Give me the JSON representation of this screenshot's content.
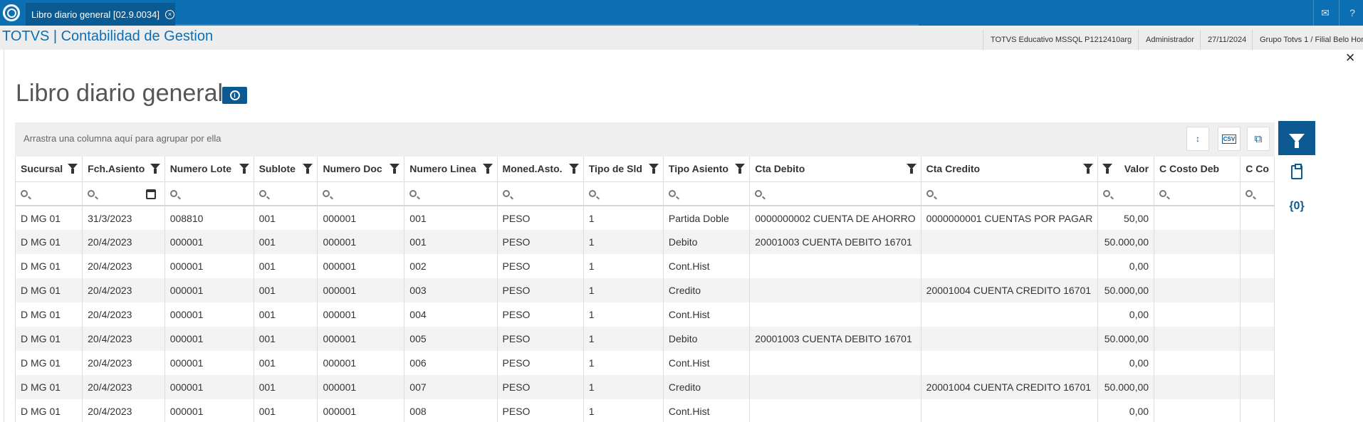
{
  "topbar": {
    "tab_label": "Libro diario general [02.9.0034]",
    "tab_close": "×",
    "mail_icon": "envelope-icon",
    "help_icon": "question-icon"
  },
  "appbar": {
    "title": "TOTVS | Contabilidad de Gestion",
    "environment": "TOTVS Educativo MSSQL P1212410arg",
    "user": "Administrador",
    "date": "27/11/2024",
    "company": "Grupo Totvs 1 / Filial Belo Hor"
  },
  "page": {
    "close": "×",
    "title": "Libro diario general",
    "info_icon": "i"
  },
  "grid": {
    "group_hint": "Arrastra una columna aquí para agrupar por ella",
    "columns": [
      "Sucursal",
      "Fch.Asiento",
      "Numero Lote",
      "Sublote",
      "Numero Doc",
      "Numero Linea",
      "Moned.Asto.",
      "Tipo de Sld",
      "Tipo Asiento",
      "Cta Debito",
      "Cta Credito",
      "Valor",
      "C Costo Deb",
      "C Co"
    ],
    "rows": [
      [
        "D MG 01",
        "31/3/2023",
        "008810",
        "001",
        "000001",
        "001",
        "PESO",
        "1",
        "Partida Doble",
        "0000000002 CUENTA DE AHORRO",
        "0000000001 CUENTAS POR PAGAR",
        "50,00",
        "",
        ""
      ],
      [
        "D MG 01",
        "20/4/2023",
        "000001",
        "001",
        "000001",
        "001",
        "PESO",
        "1",
        "Debito",
        "20001003 CUENTA DEBITO 16701",
        "",
        "50.000,00",
        "",
        ""
      ],
      [
        "D MG 01",
        "20/4/2023",
        "000001",
        "001",
        "000001",
        "002",
        "PESO",
        "1",
        "Cont.Hist",
        "",
        "",
        "0,00",
        "",
        ""
      ],
      [
        "D MG 01",
        "20/4/2023",
        "000001",
        "001",
        "000001",
        "003",
        "PESO",
        "1",
        "Credito",
        "",
        "20001004 CUENTA CREDITO 16701",
        "50.000,00",
        "",
        ""
      ],
      [
        "D MG 01",
        "20/4/2023",
        "000001",
        "001",
        "000001",
        "004",
        "PESO",
        "1",
        "Cont.Hist",
        "",
        "",
        "0,00",
        "",
        ""
      ],
      [
        "D MG 01",
        "20/4/2023",
        "000001",
        "001",
        "000001",
        "005",
        "PESO",
        "1",
        "Debito",
        "20001003 CUENTA DEBITO 16701",
        "",
        "50.000,00",
        "",
        ""
      ],
      [
        "D MG 01",
        "20/4/2023",
        "000001",
        "001",
        "000001",
        "006",
        "PESO",
        "1",
        "Cont.Hist",
        "",
        "",
        "0,00",
        "",
        ""
      ],
      [
        "D MG 01",
        "20/4/2023",
        "000001",
        "001",
        "000001",
        "007",
        "PESO",
        "1",
        "Credito",
        "",
        "20001004 CUENTA CREDITO 16701",
        "50.000,00",
        "",
        ""
      ],
      [
        "D MG 01",
        "20/4/2023",
        "000001",
        "001",
        "000001",
        "008",
        "PESO",
        "1",
        "Cont.Hist",
        "",
        "",
        "0,00",
        "",
        ""
      ]
    ]
  },
  "sidepanel": {
    "variables_label": "{0}"
  }
}
